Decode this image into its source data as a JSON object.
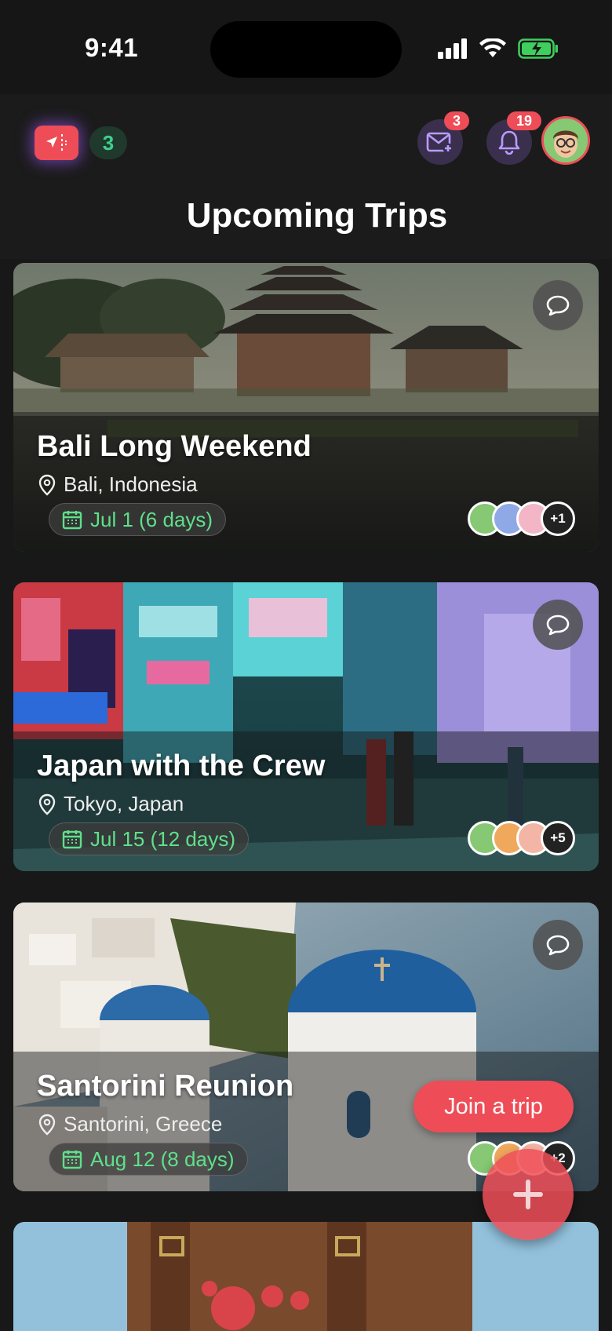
{
  "status_bar": {
    "time": "9:41"
  },
  "header": {
    "trip_count": "3",
    "messages_badge": "3",
    "notifications_badge": "19"
  },
  "page_title": "Upcoming Trips",
  "trips": [
    {
      "title": "Bali Long Weekend",
      "location": "Bali, Indonesia",
      "date": "Jul 1 (6 days)",
      "extra_members": "+1"
    },
    {
      "title": "Japan with the Crew",
      "location": "Tokyo, Japan",
      "date": "Jul 15 (12 days)",
      "extra_members": "+5"
    },
    {
      "title": "Santorini Reunion",
      "location": "Santorini, Greece",
      "date": "Aug 12 (8 days)",
      "extra_members": "+2"
    }
  ],
  "join_button": "Join a trip",
  "colors": {
    "accent": "#ee4d57",
    "date_green": "#5fe08a",
    "background": "#181818"
  }
}
